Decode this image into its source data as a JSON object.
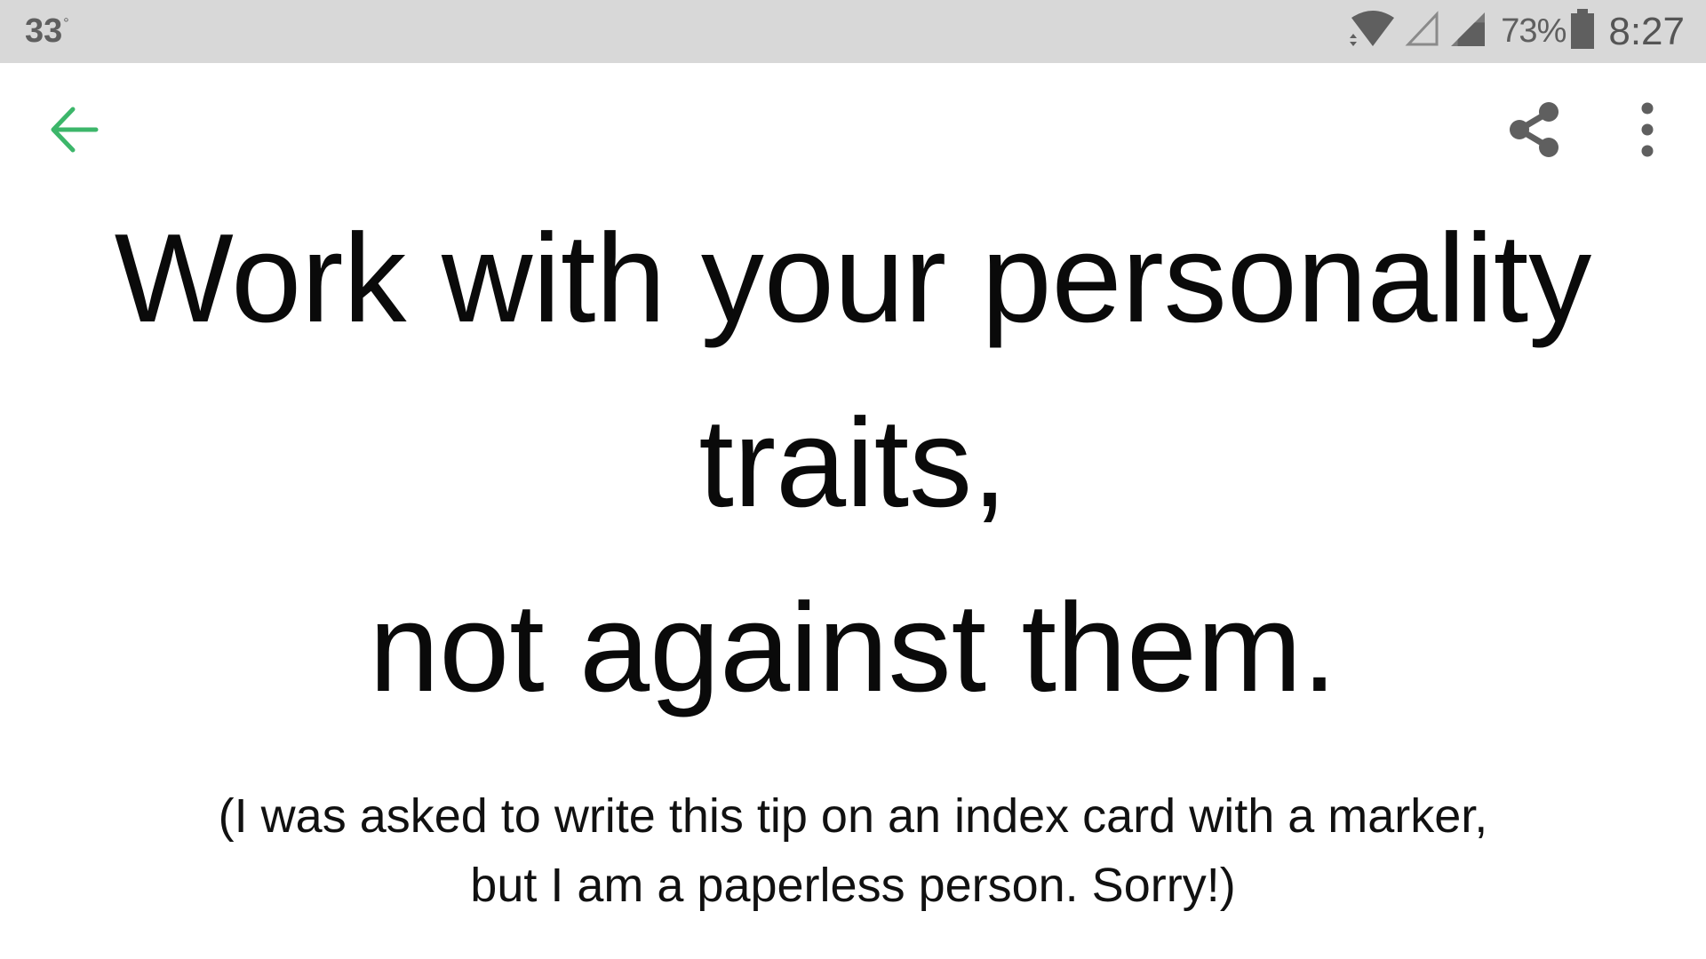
{
  "status_bar": {
    "temperature": "33",
    "degree_symbol": "°",
    "battery_percent": "73%",
    "time": "8:27",
    "icons": [
      "wifi-icon",
      "signal-empty-icon",
      "signal-icon",
      "battery-icon"
    ]
  },
  "toolbar": {
    "back_icon": "arrow-left-icon",
    "share_icon": "share-icon",
    "more_icon": "more-vert-icon"
  },
  "card": {
    "headline_lines": [
      "Work with your personality",
      "traits,",
      "not against them."
    ],
    "note_lines": [
      "(I was asked to write this tip on an index card with a marker,",
      "but I am a paperless person. Sorry!)"
    ]
  },
  "colors": {
    "status_bar_bg": "#d8d8d8",
    "accent_green": "#3cb66a",
    "icon_grey": "#5f5f5f",
    "text": "#0a0a0a"
  }
}
